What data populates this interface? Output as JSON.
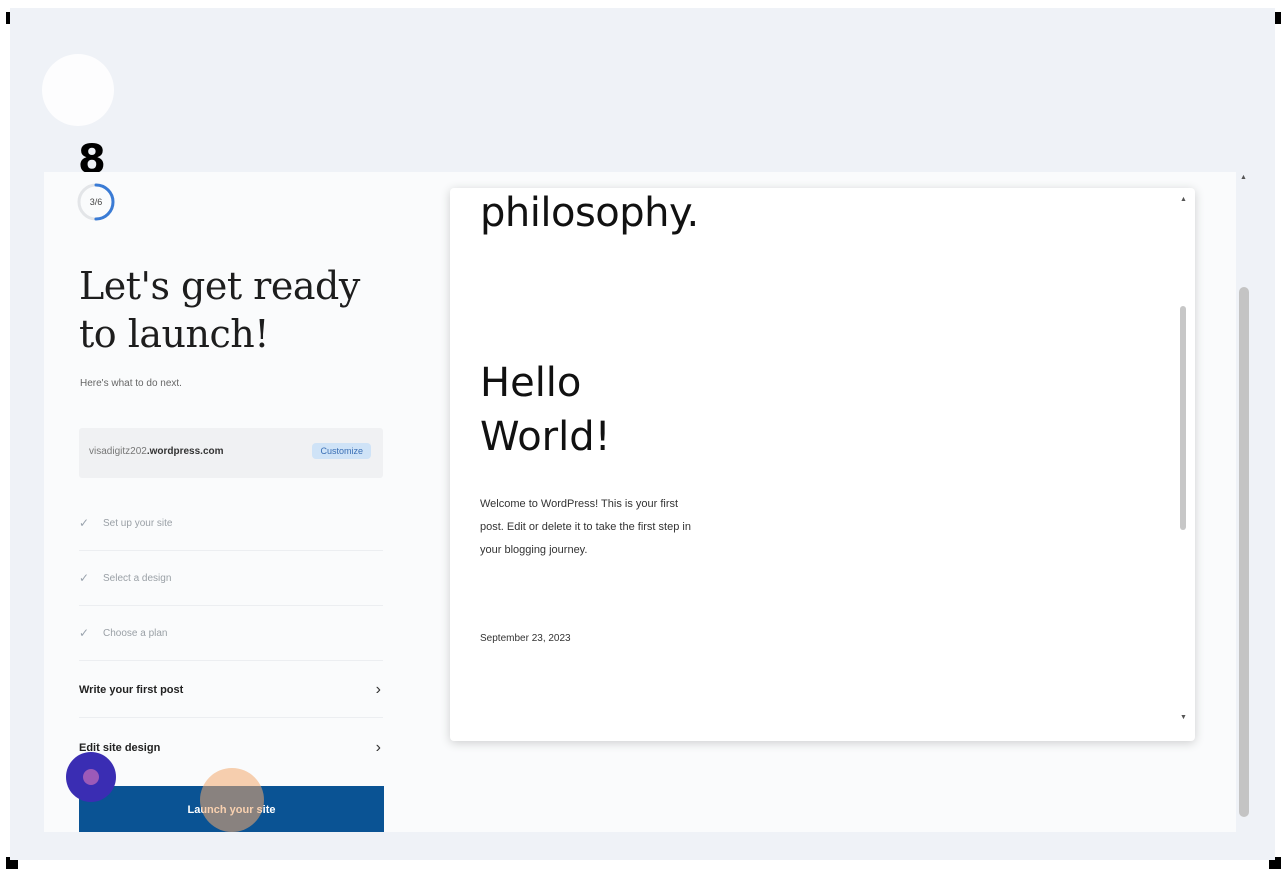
{
  "step_marker": "8",
  "progress": {
    "text": "3/6",
    "fraction": 0.5
  },
  "launchpad": {
    "title": "Let's get ready to launch!",
    "subtitle": "Here's what to do next.",
    "domain": {
      "prefix": "visadigitz202",
      "suffix": ".wordpress.com",
      "action": "Customize"
    },
    "tasks": [
      {
        "label": "Set up your site",
        "done": true
      },
      {
        "label": "Select a design",
        "done": true
      },
      {
        "label": "Choose a plan",
        "done": true
      },
      {
        "label": "Write your first post",
        "done": false
      },
      {
        "label": "Edit site design",
        "done": false
      }
    ],
    "launch_button": "Launch your site"
  },
  "preview": {
    "heading": "philosophy.",
    "post_title": "Hello World!",
    "post_body": "Welcome to WordPress! This is your first post. Edit or delete it to take the first step in your blogging journey.",
    "post_date": "September 23, 2023"
  },
  "icons": {
    "check": "checkmark-icon",
    "chevron": "chevron-right-icon"
  },
  "colors": {
    "accent": "#0a5394",
    "customize_bg": "#cfe3f7",
    "help_bubble": "#3a2db3"
  }
}
